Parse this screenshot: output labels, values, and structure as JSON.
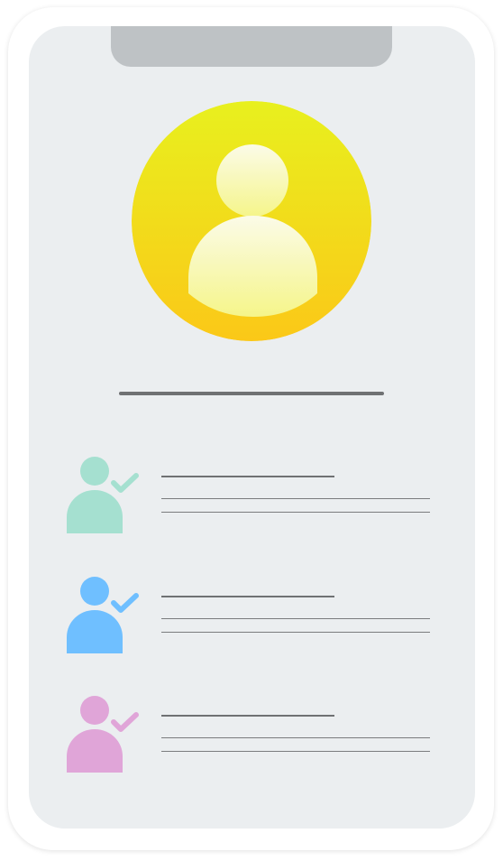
{
  "colors": {
    "background": "#ffffff",
    "device_frame": "#ffffff",
    "screen": "#ebeef0",
    "notch": "#bec2c5",
    "avatar_gradient_top": "#e8f01e",
    "avatar_gradient_bottom": "#fbc818",
    "avatar_figure_top": "#fbfbe8",
    "avatar_figure_bottom": "#f5f58a",
    "text_line_dark": "#6f7173",
    "text_line_light": "#7a7c7e"
  },
  "profile": {
    "icon": "user-avatar-icon"
  },
  "contacts": [
    {
      "icon": "user-check-icon",
      "color": "#a5e0d0"
    },
    {
      "icon": "user-check-icon",
      "color": "#6fbfff"
    },
    {
      "icon": "user-check-icon",
      "color": "#e0a5d8"
    }
  ]
}
